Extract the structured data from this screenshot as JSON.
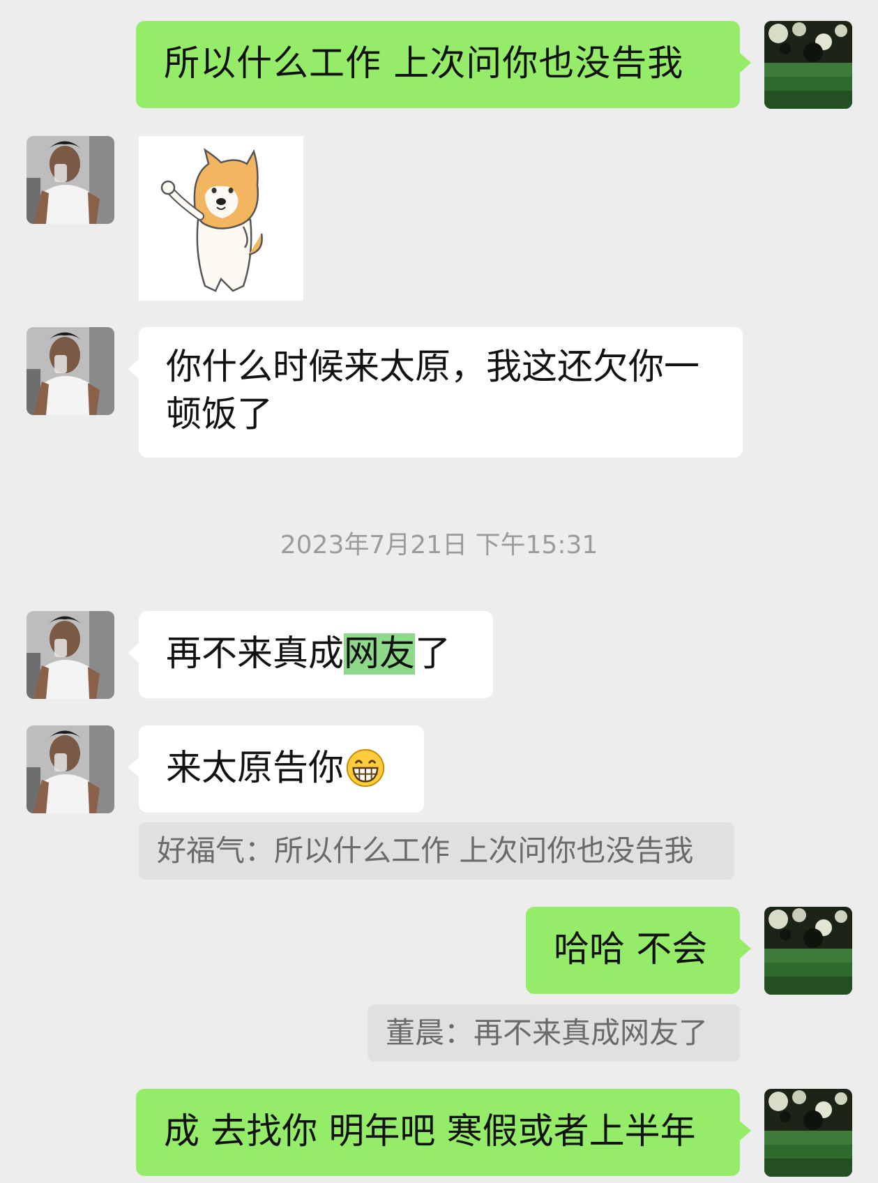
{
  "chat": {
    "messages": [
      {
        "side": "right",
        "type": "text",
        "text": "所以什么工作 上次问你也没告我"
      },
      {
        "side": "left",
        "type": "sticker",
        "sticker": "shiba-dog-waving"
      },
      {
        "side": "left",
        "type": "text",
        "text_lines": [
          "你什么时候来太原，我这还欠你一",
          "顿饭了"
        ]
      },
      {
        "type": "timestamp",
        "text": "2023年7月21日 下午15:31"
      },
      {
        "side": "left",
        "type": "text",
        "text_before": "再不来真成",
        "text_highlight": "网友",
        "text_after": "了"
      },
      {
        "side": "left",
        "type": "text",
        "text": "来太原告你",
        "emoji": "grinning-face"
      },
      {
        "type": "quote",
        "side": "left",
        "text": "好福气：所以什么工作 上次问你也没告我"
      },
      {
        "side": "right",
        "type": "text",
        "text": "哈哈 不会"
      },
      {
        "type": "quote",
        "side": "right",
        "text": "董晨：再不来真成网友了"
      },
      {
        "side": "right",
        "type": "text",
        "text": "成 去找你 明年吧 寒假或者上半年"
      }
    ]
  },
  "colors": {
    "background": "#ededed",
    "self_bubble": "#95ec69",
    "other_bubble": "#ffffff",
    "quote_bg": "#e0e0e0",
    "highlight": "#8fd98a"
  }
}
